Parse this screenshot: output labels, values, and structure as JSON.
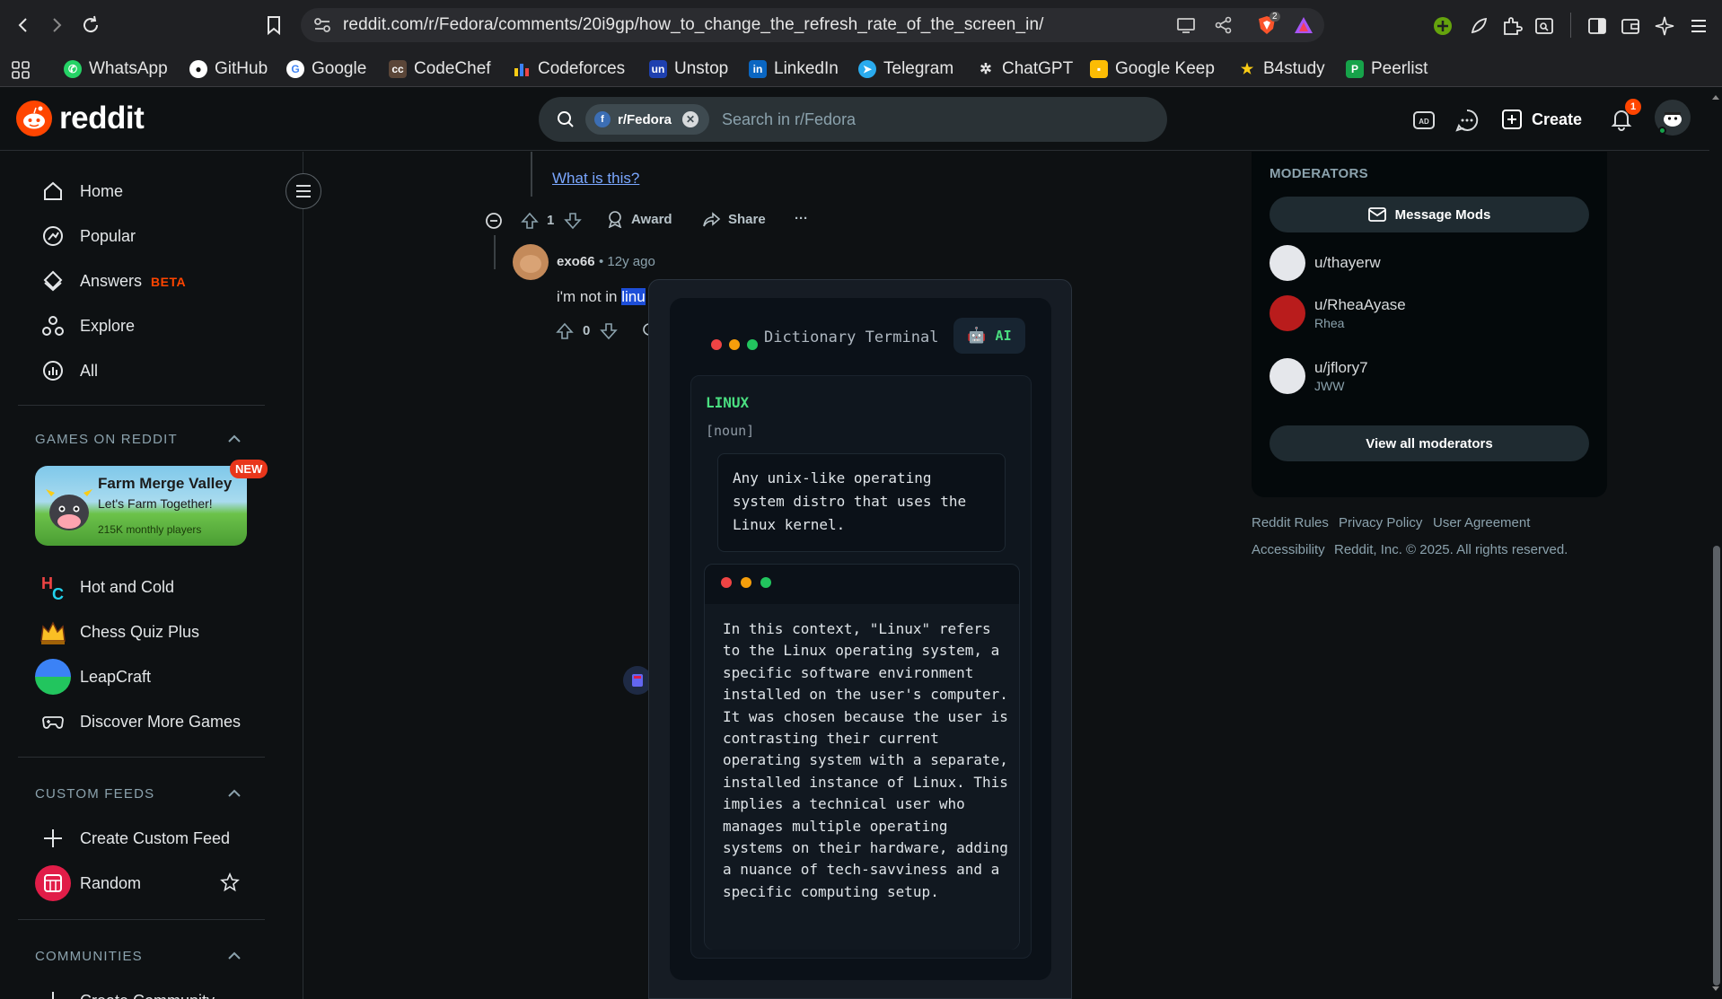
{
  "browser": {
    "url": "reddit.com/r/Fedora/comments/20i9gp/how_to_change_the_refresh_rate_of_the_screen_in/",
    "bookmarks": [
      "WhatsApp",
      "GitHub",
      "Google",
      "CodeChef",
      "Codeforces",
      "Unstop",
      "LinkedIn",
      "Telegram",
      "ChatGPT",
      "Google Keep",
      "B4study",
      "Peerlist"
    ],
    "shield_count": "2"
  },
  "header": {
    "logo_text": "reddit",
    "search_chip": "r/Fedora",
    "search_placeholder": "Search in r/Fedora",
    "create_label": "Create",
    "notification_count": "1"
  },
  "sidebar": {
    "nav": [
      {
        "label": "Home",
        "icon": "home-icon"
      },
      {
        "label": "Popular",
        "icon": "popular-icon"
      },
      {
        "label": "Answers",
        "icon": "answers-icon",
        "badge": "BETA"
      },
      {
        "label": "Explore",
        "icon": "explore-icon"
      },
      {
        "label": "All",
        "icon": "all-icon"
      }
    ],
    "games_heading": "GAMES ON REDDIT",
    "featured_game": {
      "title": "Farm Merge Valley",
      "subtitle": "Let's Farm Together!",
      "players": "215K monthly players",
      "badge": "NEW"
    },
    "games": [
      "Hot and Cold",
      "Chess Quiz Plus",
      "LeapCraft",
      "Discover More Games"
    ],
    "custom_feeds_heading": "CUSTOM FEEDS",
    "custom_feeds": [
      "Create Custom Feed",
      "Random"
    ],
    "communities_heading": "COMMUNITIES",
    "communities_partial": "Create Community"
  },
  "thread": {
    "link_text": "What is this?",
    "comment1": {
      "votes": "1",
      "award": "Award",
      "share": "Share",
      "more": "···"
    },
    "comment2": {
      "author": "exo66",
      "time": "• 12y ago",
      "text": "i'm not in ",
      "highlight": "linu",
      "votes": "0"
    }
  },
  "popup": {
    "title": "Dictionary Terminal",
    "ai_label": "AI",
    "ai_emoji": "🤖",
    "word": "LINUX",
    "part_of_speech": "[noun]",
    "definition": "Any unix-like operating system distro that uses the Linux kernel.",
    "context": "In this context, \"Linux\" refers to the Linux operating system, a specific software environment installed on the user's computer. It was chosen because the user is contrasting their current operating system with a separate, installed instance of Linux. This implies a technical user who manages multiple operating systems on their hardware, adding a nuance of tech-savviness and a specific computing setup."
  },
  "right_sidebar": {
    "heading": "MODERATORS",
    "message_mods": "Message Mods",
    "moderators": [
      {
        "name": "u/thayerw",
        "flair": ""
      },
      {
        "name": "u/RheaAyase",
        "flair": "Rhea"
      },
      {
        "name": "u/jflory7",
        "flair": "JWW"
      }
    ],
    "view_all": "View all moderators",
    "footer": [
      "Reddit Rules",
      "Privacy Policy",
      "User Agreement",
      "Accessibility",
      "Reddit, Inc. © 2025. All rights reserved."
    ]
  },
  "colors": {
    "reddit_orange": "#ff4500",
    "terminal_green": "#4ade80",
    "background": "#0e1113"
  }
}
